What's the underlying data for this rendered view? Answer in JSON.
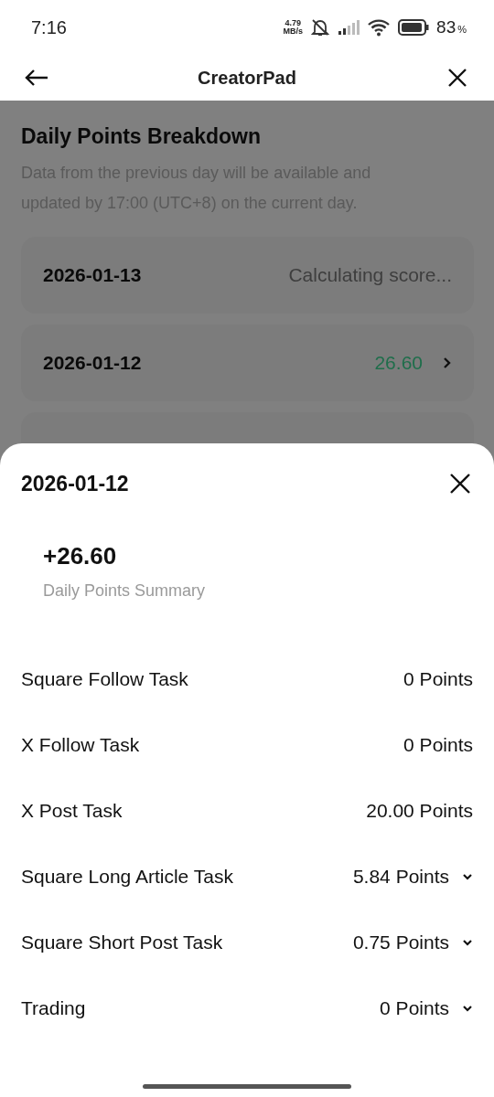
{
  "status_bar": {
    "time": "7:16",
    "speed_value": "4.79",
    "speed_unit": "MB/s",
    "battery": "83",
    "battery_unit": "%"
  },
  "header": {
    "title": "CreatorPad"
  },
  "page": {
    "title": "Daily Points Breakdown",
    "note": "Data from the previous day will be available and updated by 17:00 (UTC+8) on the current day.",
    "days": [
      {
        "date": "2026-01-13",
        "kind": "pending",
        "value": "Calculating score..."
      },
      {
        "date": "2026-01-12",
        "kind": "scored",
        "value": "26.60"
      }
    ]
  },
  "sheet": {
    "date": "2026-01-12",
    "total": "+26.60",
    "total_label": "Daily Points Summary",
    "tasks": [
      {
        "label": "Square Follow Task",
        "points": "0 Points",
        "expandable": false
      },
      {
        "label": "X Follow Task",
        "points": "0 Points",
        "expandable": false
      },
      {
        "label": "X Post Task",
        "points": "20.00 Points",
        "expandable": false
      },
      {
        "label": "Square Long Article Task",
        "points": "5.84 Points",
        "expandable": true
      },
      {
        "label": "Square Short Post Task",
        "points": "0.75 Points",
        "expandable": true
      },
      {
        "label": "Trading",
        "points": "0 Points",
        "expandable": true
      }
    ]
  }
}
